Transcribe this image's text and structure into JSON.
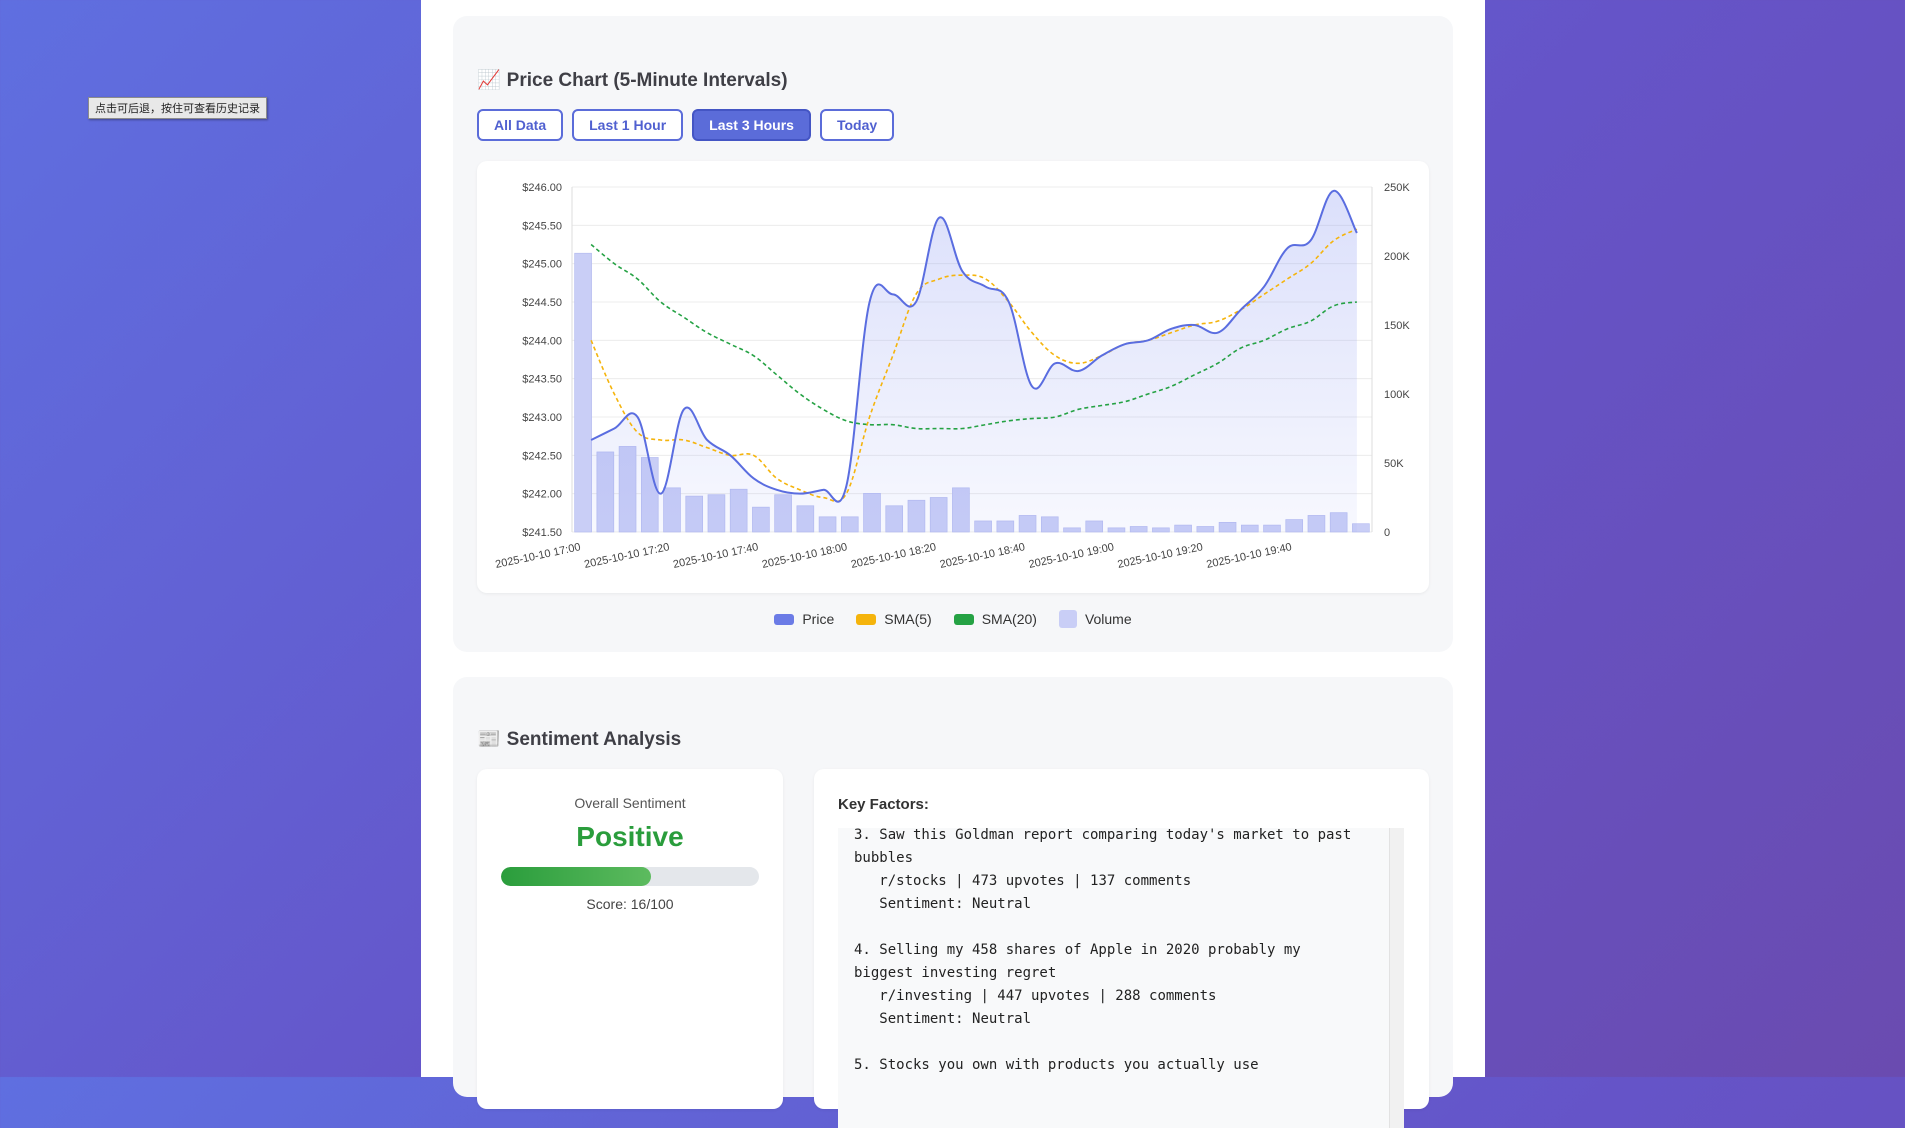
{
  "tooltip": "点击可后退，按住可查看历史记录",
  "price_chart": {
    "icon": "📈",
    "title": "Price Chart (5-Minute Intervals)",
    "buttons": [
      {
        "label": "All Data",
        "active": false
      },
      {
        "label": "Last 1 Hour",
        "active": false
      },
      {
        "label": "Last 3 Hours",
        "active": true
      },
      {
        "label": "Today",
        "active": false
      }
    ],
    "legend": [
      {
        "label": "Price",
        "color": "#6b7be6"
      },
      {
        "label": "SMA(5)",
        "color": "#f5b40c"
      },
      {
        "label": "SMA(20)",
        "color": "#25a244"
      },
      {
        "label": "Volume",
        "color": "#c9cef6"
      }
    ]
  },
  "chart_data": {
    "type": "line",
    "x_tick_labels": [
      "2025-10-10 17:00",
      "2025-10-10 17:20",
      "2025-10-10 17:40",
      "2025-10-10 18:00",
      "2025-10-10 18:20",
      "2025-10-10 18:40",
      "2025-10-10 19:00",
      "2025-10-10 19:20",
      "2025-10-10 19:40"
    ],
    "y_left_ticks": [
      "$241.50",
      "$242.00",
      "$242.50",
      "$243.00",
      "$243.50",
      "$244.00",
      "$244.50",
      "$245.00",
      "$245.50",
      "$246.00"
    ],
    "y_right_ticks": [
      "0",
      "50K",
      "100K",
      "150K",
      "200K",
      "250K"
    ],
    "ylim": [
      241.5,
      246.0
    ],
    "y2lim": [
      0,
      250000
    ],
    "series": [
      {
        "name": "Price",
        "type": "area",
        "values": [
          242.7,
          242.85,
          243.0,
          242.0,
          243.1,
          242.7,
          242.5,
          242.2,
          242.05,
          242.0,
          242.05,
          242.1,
          244.5,
          244.6,
          244.5,
          245.6,
          244.9,
          244.7,
          244.5,
          243.4,
          243.7,
          243.6,
          243.8,
          243.95,
          244.0,
          244.15,
          244.2,
          244.1,
          244.4,
          244.7,
          245.2,
          245.3,
          245.95,
          245.4
        ]
      },
      {
        "name": "SMA(5)",
        "type": "line",
        "values": [
          244.0,
          243.3,
          242.8,
          242.7,
          242.7,
          242.6,
          242.5,
          242.5,
          242.2,
          242.05,
          241.95,
          242.0,
          243.0,
          243.8,
          244.6,
          244.8,
          244.85,
          244.8,
          244.5,
          244.1,
          243.8,
          243.7,
          243.8,
          243.95,
          244.0,
          244.1,
          244.2,
          244.25,
          244.4,
          244.6,
          244.8,
          245.0,
          245.3,
          245.45
        ]
      },
      {
        "name": "SMA(20)",
        "type": "line",
        "values": [
          245.25,
          245.0,
          244.8,
          244.5,
          244.3,
          244.1,
          243.95,
          243.8,
          243.55,
          243.3,
          243.1,
          242.95,
          242.9,
          242.9,
          242.85,
          242.85,
          242.85,
          242.9,
          242.95,
          242.98,
          243.0,
          243.1,
          243.15,
          243.2,
          243.3,
          243.4,
          243.55,
          243.7,
          243.9,
          244.0,
          244.15,
          244.25,
          244.45,
          244.5
        ]
      },
      {
        "name": "Volume",
        "type": "bar",
        "axis": "right",
        "values": [
          202000,
          58000,
          62000,
          54000,
          32000,
          26000,
          27000,
          31000,
          18000,
          27000,
          19000,
          11000,
          11000,
          28000,
          19000,
          23000,
          25000,
          32000,
          8000,
          8000,
          12000,
          11000,
          3000,
          8000,
          3000,
          4000,
          3000,
          5000,
          4000,
          7000,
          5000,
          5000,
          9000,
          12000,
          14000,
          6000
        ]
      }
    ],
    "grid": true,
    "legend_position": "bottom"
  },
  "sentiment": {
    "icon": "📰",
    "title": "Sentiment Analysis",
    "overall_label": "Overall Sentiment",
    "overall_value": "Positive",
    "score_fraction": 0.58,
    "score_text": "Score: 16/100",
    "key_factors_title": "Key Factors:",
    "key_factors_text": "3. Saw this Goldman report comparing today's market to past bubbles\n   r/stocks | 473 upvotes | 137 comments\n   Sentiment: Neutral\n\n4. Selling my 458 shares of Apple in 2020 probably my biggest investing regret\n   r/investing | 447 upvotes | 288 comments\n   Sentiment: Neutral\n\n5. Stocks you own with products you actually use"
  }
}
